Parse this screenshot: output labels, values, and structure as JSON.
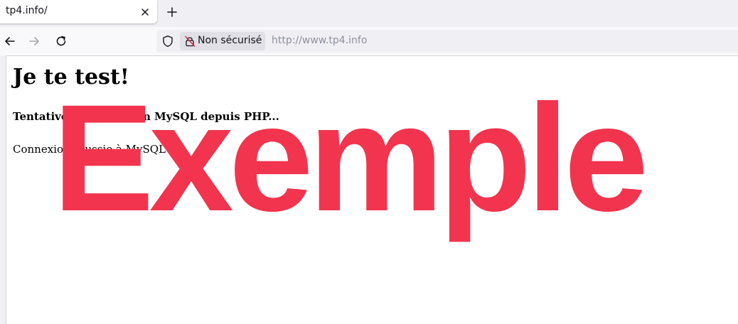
{
  "browser": {
    "tab": {
      "title": "tp4.info/"
    },
    "security": {
      "label": "Non sécurisé"
    },
    "url": "http://www.tp4.info"
  },
  "page": {
    "heading": "Je te test!",
    "subheading": "Tentative de connexion MySQL depuis PHP...",
    "message": "Connexion réussie à MySQL !"
  },
  "watermark": {
    "text": "Exemple",
    "color": "#f3344e"
  }
}
